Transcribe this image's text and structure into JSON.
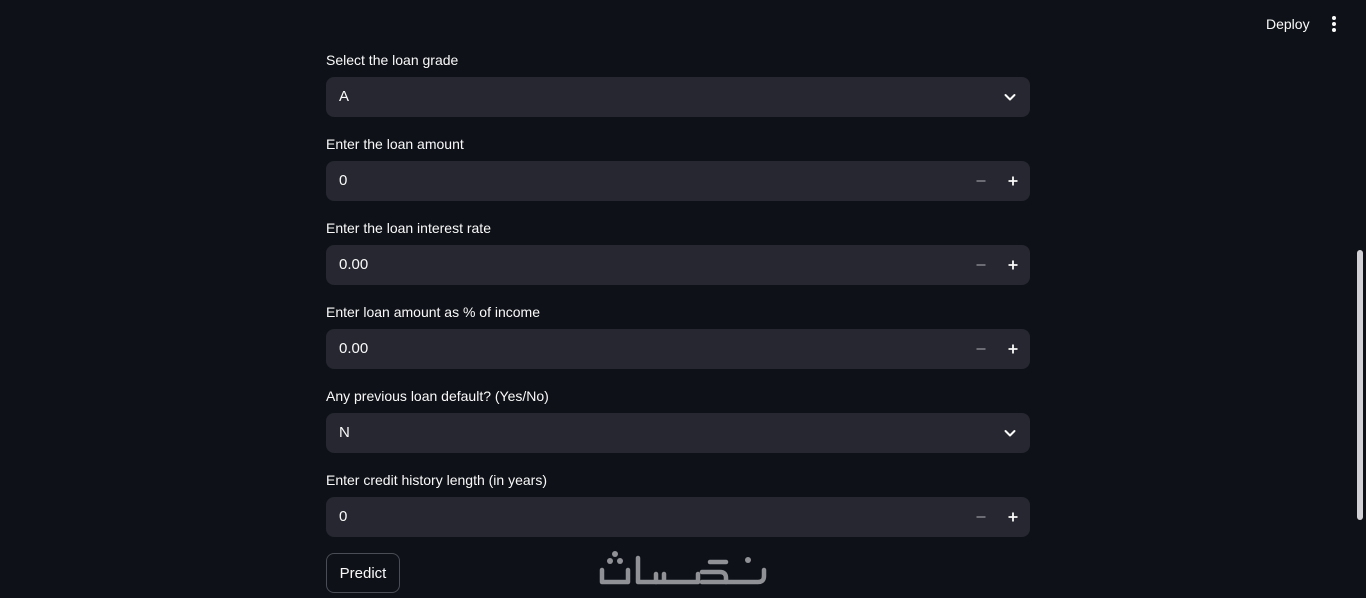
{
  "header": {
    "deploy_label": "Deploy",
    "menu_icon": "vertical-dots-icon"
  },
  "form": {
    "fields": [
      {
        "label": "Select the loan grade",
        "type": "select",
        "value": "A"
      },
      {
        "label": "Enter the loan amount",
        "type": "number",
        "value": "0"
      },
      {
        "label": "Enter the loan interest rate",
        "type": "number",
        "value": "0.00"
      },
      {
        "label": "Enter loan amount as % of income",
        "type": "number",
        "value": "0.00"
      },
      {
        "label": "Any previous loan default? (Yes/No)",
        "type": "select",
        "value": "N"
      },
      {
        "label": "Enter credit history length (in years)",
        "type": "number",
        "value": "0"
      }
    ],
    "predict_label": "Predict"
  },
  "colors": {
    "background": "#0e1117",
    "input_background": "#262730",
    "text": "#fafafa",
    "muted_icon": "#8a8b93"
  },
  "watermark": {
    "text": "خمسات"
  }
}
